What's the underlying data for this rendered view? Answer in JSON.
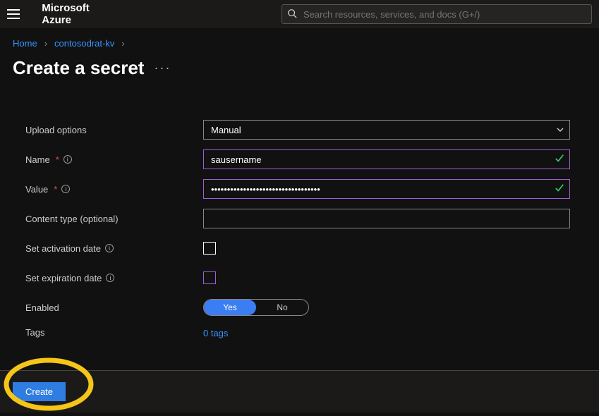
{
  "header": {
    "brand": "Microsoft Azure",
    "search_placeholder": "Search resources, services, and docs (G+/)"
  },
  "breadcrumb": {
    "home": "Home",
    "resource": "contosodrat-kv"
  },
  "page": {
    "title": "Create a secret"
  },
  "form": {
    "upload_options_label": "Upload options",
    "upload_options_value": "Manual",
    "name_label": "Name",
    "name_value": "sausername",
    "value_label": "Value",
    "value_value": "••••••••••••••••••••••••••••••••••",
    "content_type_label": "Content type (optional)",
    "content_type_value": "",
    "activation_label": "Set activation date",
    "activation_checked": false,
    "expiration_label": "Set expiration date",
    "expiration_checked": false,
    "enabled_label": "Enabled",
    "enabled_yes": "Yes",
    "enabled_no": "No",
    "enabled_value": "Yes",
    "tags_label": "Tags",
    "tags_link": "0 tags"
  },
  "footer": {
    "create_label": "Create"
  }
}
